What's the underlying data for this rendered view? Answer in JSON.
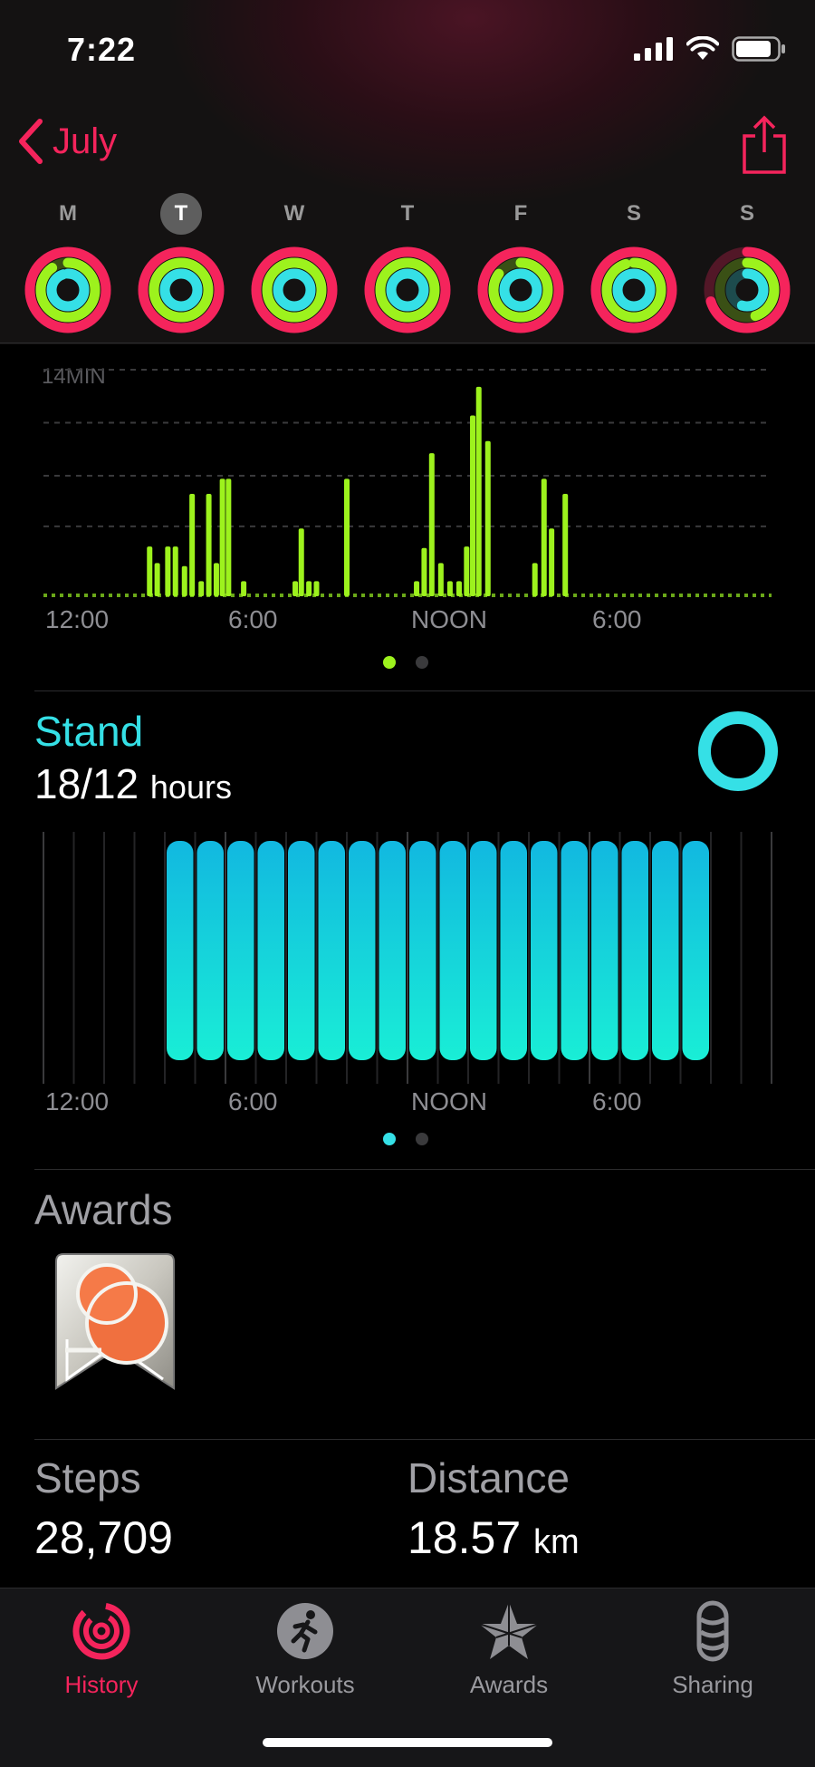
{
  "status": {
    "time": "7:22"
  },
  "nav": {
    "back_label": "July"
  },
  "week": {
    "days": [
      {
        "letter": "M",
        "move": 1.0,
        "exercise": 0.9,
        "stand": 0.95,
        "today": false
      },
      {
        "letter": "T",
        "move": 1.0,
        "exercise": 1.0,
        "stand": 1.0,
        "today": true
      },
      {
        "letter": "W",
        "move": 1.0,
        "exercise": 1.0,
        "stand": 1.0,
        "today": false
      },
      {
        "letter": "T",
        "move": 1.0,
        "exercise": 1.0,
        "stand": 1.0,
        "today": false
      },
      {
        "letter": "F",
        "move": 1.0,
        "exercise": 0.85,
        "stand": 1.0,
        "today": false
      },
      {
        "letter": "S",
        "move": 1.0,
        "exercise": 0.95,
        "stand": 1.0,
        "today": false
      },
      {
        "letter": "S",
        "move": 0.7,
        "exercise": 0.45,
        "stand": 0.55,
        "today": false
      }
    ]
  },
  "colors": {
    "move": "#f5245c",
    "exercise": "#9df21d",
    "stand": "#35e0e6"
  },
  "exercise_chart": {
    "ylabel": "14MIN",
    "x_labels": [
      "12:00",
      "6:00",
      "NOON",
      "6:00"
    ]
  },
  "stand": {
    "title": "Stand",
    "value": "18/12",
    "unit": "hours",
    "x_labels": [
      "12:00",
      "6:00",
      "NOON",
      "6:00"
    ]
  },
  "awards": {
    "title": "Awards"
  },
  "steps": {
    "title": "Steps",
    "value": "28,709"
  },
  "distance": {
    "title": "Distance",
    "value": "18.57",
    "unit": "km"
  },
  "tabs": [
    {
      "label": "History",
      "active": true,
      "icon": "history-icon"
    },
    {
      "label": "Workouts",
      "active": false,
      "icon": "workouts-icon"
    },
    {
      "label": "Awards",
      "active": false,
      "icon": "awards-icon"
    },
    {
      "label": "Sharing",
      "active": false,
      "icon": "sharing-icon"
    }
  ],
  "chart_data": [
    {
      "type": "bar",
      "title": "",
      "ylabel": "14MIN",
      "x_tick_labels": [
        "12:00",
        "6:00",
        "NOON",
        "6:00"
      ],
      "ylim": [
        0,
        16
      ],
      "x": [
        3.5,
        3.75,
        4.1,
        4.35,
        4.65,
        4.9,
        5.2,
        5.45,
        5.7,
        5.9,
        6.1,
        6.6,
        8.3,
        8.5,
        8.75,
        9.0,
        10.0,
        12.3,
        12.55,
        12.8,
        13.1,
        13.4,
        13.7,
        13.95,
        14.15,
        14.35,
        14.65,
        16.2,
        16.5,
        16.75,
        17.2
      ],
      "values": [
        3.3,
        2.2,
        3.3,
        3.3,
        2.0,
        6.8,
        1.0,
        6.8,
        2.2,
        7.8,
        7.8,
        1.0,
        1.0,
        4.5,
        1.0,
        1.0,
        7.8,
        1.0,
        3.2,
        9.5,
        2.2,
        1.0,
        1.0,
        3.3,
        12.0,
        13.9,
        10.3,
        2.2,
        7.8,
        4.5,
        6.8
      ]
    },
    {
      "type": "bar",
      "title": "Stand",
      "x_tick_labels": [
        "12:00",
        "6:00",
        "NOON",
        "6:00"
      ],
      "categories": [
        "0",
        "1",
        "2",
        "3",
        "4",
        "5",
        "6",
        "7",
        "8",
        "9",
        "10",
        "11",
        "12",
        "13",
        "14",
        "15",
        "16",
        "17",
        "18",
        "19",
        "20",
        "21",
        "22",
        "23"
      ],
      "values": [
        0,
        0,
        0,
        0,
        1,
        1,
        1,
        1,
        1,
        1,
        1,
        1,
        1,
        1,
        1,
        1,
        1,
        1,
        1,
        1,
        1,
        1,
        0,
        0
      ]
    }
  ]
}
